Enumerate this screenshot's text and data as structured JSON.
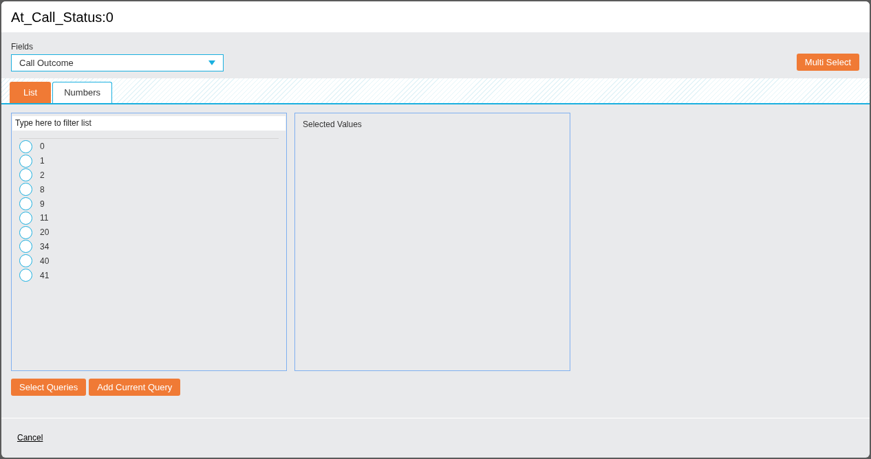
{
  "dialog": {
    "title": "At_Call_Status:0"
  },
  "fields": {
    "label": "Fields",
    "value": "Call Outcome"
  },
  "multi_select_button": "Multi Select",
  "tabs": [
    {
      "label": "List",
      "selected": true
    },
    {
      "label": "Numbers",
      "selected": false
    }
  ],
  "filter": {
    "placeholder": "Type here to filter list"
  },
  "options": [
    {
      "label": "0",
      "selected": false
    },
    {
      "label": "1",
      "selected": false
    },
    {
      "label": "2",
      "selected": false
    },
    {
      "label": "8",
      "selected": false
    },
    {
      "label": "9",
      "selected": false
    },
    {
      "label": "11",
      "selected": false
    },
    {
      "label": "20",
      "selected": false
    },
    {
      "label": "34",
      "selected": false
    },
    {
      "label": "40",
      "selected": false
    },
    {
      "label": "41",
      "selected": false
    }
  ],
  "selected_values": {
    "title": "Selected Values"
  },
  "actions": [
    "Select Queries",
    "Add Current Query"
  ],
  "footer": {
    "cancel": "Cancel"
  }
}
